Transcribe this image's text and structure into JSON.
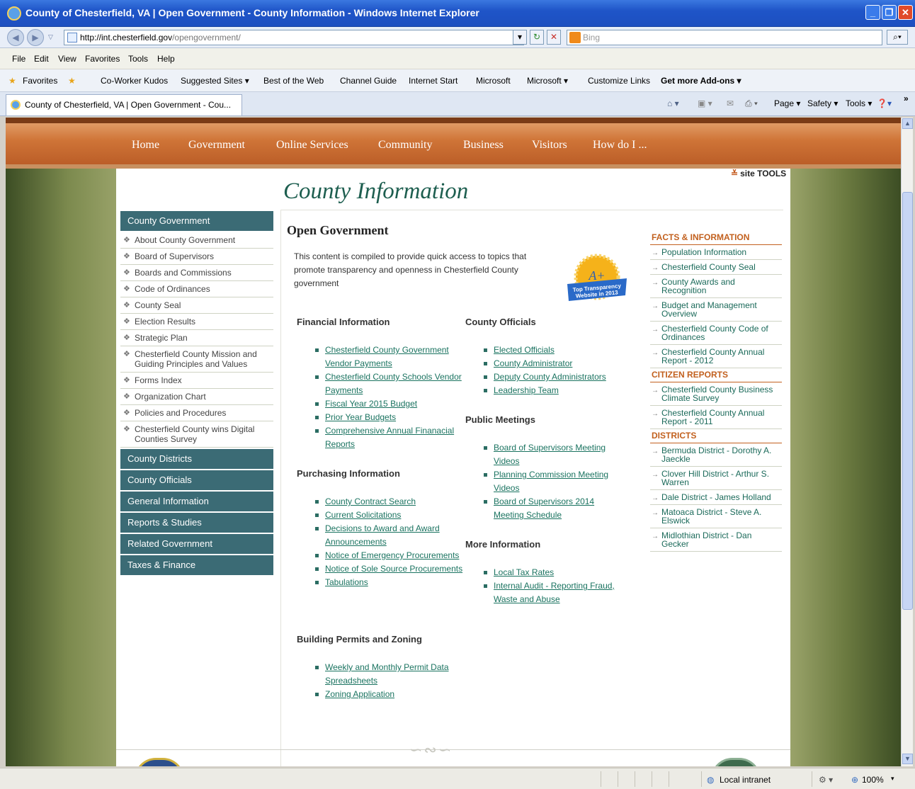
{
  "window": {
    "title": "County of Chesterfield, VA | Open Government - County Information - Windows Internet Explorer"
  },
  "addressbar": {
    "url_host": "http://int.chesterfield.gov",
    "url_path": "/opengovernment/",
    "search_placeholder": "Bing"
  },
  "menubar": {
    "items": [
      "File",
      "Edit",
      "View",
      "Favorites",
      "Tools",
      "Help"
    ]
  },
  "favorites": {
    "items": [
      "Favorites",
      "Co-Worker Kudos",
      "Suggested Sites ▾",
      "Best of the Web",
      "Channel Guide",
      "Internet Start",
      "Microsoft",
      "Microsoft ▾",
      "Customize Links",
      "Get more Add-ons ▾"
    ]
  },
  "tab": {
    "title": "County of Chesterfield, VA | Open Government - Cou..."
  },
  "commandbar": {
    "page": "Page ▾",
    "safety": "Safety ▾",
    "tools": "Tools ▾"
  },
  "site": {
    "nav": [
      "Home",
      "Government",
      "Online Services",
      "Community",
      "Business",
      "Visitors",
      "How do I ..."
    ],
    "site_tools": "site TOOLS",
    "page_title": "County Information",
    "leftnav": {
      "section_title": "County Government",
      "items": [
        "About County Government",
        "Board of Supervisors",
        "Boards and Commissions",
        "Code of Ordinances",
        "County Seal",
        "Election Results",
        "Strategic Plan",
        "Chesterfield County Mission and Guiding Principles and Values",
        "Forms Index",
        "Organization Chart",
        "Policies and Procedures",
        "Chesterfield County wins Digital Counties Survey"
      ],
      "sections": [
        "County Districts",
        "County Officials",
        "General Information",
        "Reports & Studies",
        "Related Government",
        "Taxes & Finance"
      ]
    },
    "main": {
      "heading": "Open Government",
      "intro": "This content is compiled to provide quick access to topics that promote transparency and openness in Chesterfield County government",
      "badge": {
        "grade": "A+",
        "line1": "Top Transparency",
        "line2": "Website in 2013"
      },
      "financial": {
        "title": "Financial Information",
        "links": [
          "Chesterfield County Government Vendor Payments",
          "Chesterfield County Schools Vendor Payments",
          "Fiscal Year 2015 Budget ",
          "Prior Year Budgets",
          "Comprehensive Annual Finanacial Reports"
        ]
      },
      "purchasing": {
        "title": "Purchasing Information",
        "links": [
          "County Contract Search ",
          "Current Solicitations",
          "Decisions to Award and Award Announcements",
          "Notice of Emergency Procurements",
          "Notice of Sole Source Procurements",
          "Tabulations"
        ]
      },
      "building": {
        "title": "Building Permits and Zoning",
        "links": [
          "Weekly and Monthly Permit Data Spreadsheets",
          "Zoning Application"
        ]
      },
      "officials": {
        "title": "County Officials",
        "links": [
          "Elected Officials",
          "County Administrator",
          "Deputy County Administrators",
          "Leadership Team"
        ]
      },
      "meetings": {
        "title": "Public Meetings",
        "links": [
          "Board of Supervisors Meeting Videos",
          "Planning Commission Meeting Videos",
          "Board of Supervisors 2014 Meeting Schedule"
        ]
      },
      "more": {
        "title": "More Information",
        "links": [
          "Local Tax Rates",
          "Internal Audit - Reporting Fraud, Waste and Abuse"
        ]
      }
    },
    "rightcol": {
      "facts": {
        "title": "FACTS & INFORMATION",
        "items": [
          "Population Information",
          "Chesterfield County Seal",
          "County Awards and Recognition",
          "Budget and Management Overview",
          "Chesterfield County Code of Ordinances",
          "Chesterfield County Annual Report - 2012"
        ]
      },
      "citizen": {
        "title": "CITIZEN REPORTS",
        "items": [
          "Chesterfield County Business Climate Survey",
          "Chesterfield County Annual Report - 2011"
        ]
      },
      "districts": {
        "title": "DISTRICTS",
        "items": [
          "Bermuda District - Dorothy A. Jaeckle",
          "Clover Hill District - Arthur S. Warren",
          "Dale District - James Holland",
          "Matoaca District - Steve A. Elswick",
          "Midlothian District - Dan Gecker"
        ]
      }
    }
  },
  "statusbar": {
    "zone": "Local intranet",
    "zoom": "100%"
  }
}
